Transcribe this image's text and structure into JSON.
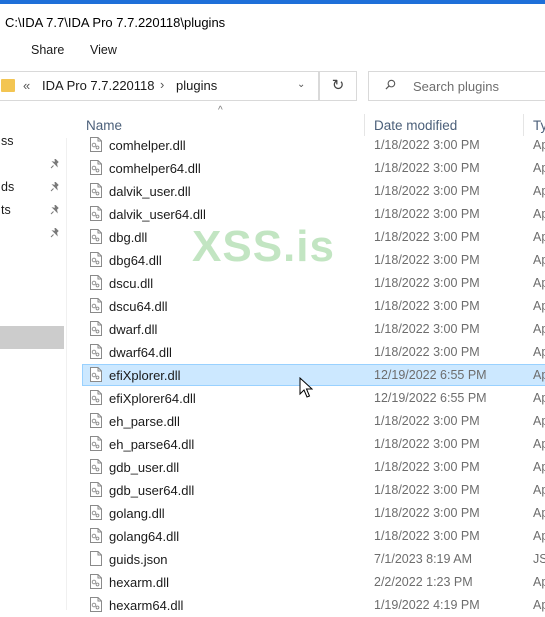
{
  "window": {
    "title": "C:\\IDA 7.7\\IDA Pro 7.7.220118\\plugins"
  },
  "ribbon": {
    "tabs": [
      "Share",
      "View"
    ]
  },
  "address": {
    "separator": "«",
    "crumbs": [
      "IDA Pro 7.7.220118",
      "plugins"
    ],
    "crumb_separator": "›",
    "dropdown_glyph": "⌄",
    "refresh_glyph": "↻"
  },
  "search": {
    "placeholder": "Search plugins"
  },
  "nav": {
    "items": [
      {
        "label": "ss",
        "pinned": false
      },
      {
        "label": "",
        "pinned": true
      },
      {
        "label": "ds",
        "pinned": true
      },
      {
        "label": "ts",
        "pinned": true
      },
      {
        "label": "",
        "pinned": true
      }
    ]
  },
  "columns": {
    "name": "Name",
    "date": "Date modified",
    "type": "Ty"
  },
  "files": [
    {
      "name": "comhelper.dll",
      "date": "1/18/2022 3:00 PM",
      "type": "Ap"
    },
    {
      "name": "comhelper64.dll",
      "date": "1/18/2022 3:00 PM",
      "type": "Ap"
    },
    {
      "name": "dalvik_user.dll",
      "date": "1/18/2022 3:00 PM",
      "type": "Ap"
    },
    {
      "name": "dalvik_user64.dll",
      "date": "1/18/2022 3:00 PM",
      "type": "Ap"
    },
    {
      "name": "dbg.dll",
      "date": "1/18/2022 3:00 PM",
      "type": "Ap"
    },
    {
      "name": "dbg64.dll",
      "date": "1/18/2022 3:00 PM",
      "type": "Ap"
    },
    {
      "name": "dscu.dll",
      "date": "1/18/2022 3:00 PM",
      "type": "Ap"
    },
    {
      "name": "dscu64.dll",
      "date": "1/18/2022 3:00 PM",
      "type": "Ap"
    },
    {
      "name": "dwarf.dll",
      "date": "1/18/2022 3:00 PM",
      "type": "Ap"
    },
    {
      "name": "dwarf64.dll",
      "date": "1/18/2022 3:00 PM",
      "type": "Ap"
    },
    {
      "name": "efiXplorer.dll",
      "date": "12/19/2022 6:55 PM",
      "type": "Ap",
      "selected": true
    },
    {
      "name": "efiXplorer64.dll",
      "date": "12/19/2022 6:55 PM",
      "type": "Ap"
    },
    {
      "name": "eh_parse.dll",
      "date": "1/18/2022 3:00 PM",
      "type": "Ap"
    },
    {
      "name": "eh_parse64.dll",
      "date": "1/18/2022 3:00 PM",
      "type": "Ap"
    },
    {
      "name": "gdb_user.dll",
      "date": "1/18/2022 3:00 PM",
      "type": "Ap"
    },
    {
      "name": "gdb_user64.dll",
      "date": "1/18/2022 3:00 PM",
      "type": "Ap"
    },
    {
      "name": "golang.dll",
      "date": "1/18/2022 3:00 PM",
      "type": "Ap"
    },
    {
      "name": "golang64.dll",
      "date": "1/18/2022 3:00 PM",
      "type": "Ap"
    },
    {
      "name": "guids.json",
      "date": "7/1/2023 8:19 AM",
      "type": "JS"
    },
    {
      "name": "hexarm.dll",
      "date": "2/2/2022 1:23 PM",
      "type": "Ap"
    },
    {
      "name": "hexarm64.dll",
      "date": "1/19/2022 4:19 PM",
      "type": "Ap"
    }
  ],
  "watermark": {
    "text": "XSS.is"
  },
  "colors": {
    "selection": "#cce8ff",
    "selection_border": "#99d1ff",
    "header_text": "#4c607a",
    "accent": "#1e6fd9"
  }
}
